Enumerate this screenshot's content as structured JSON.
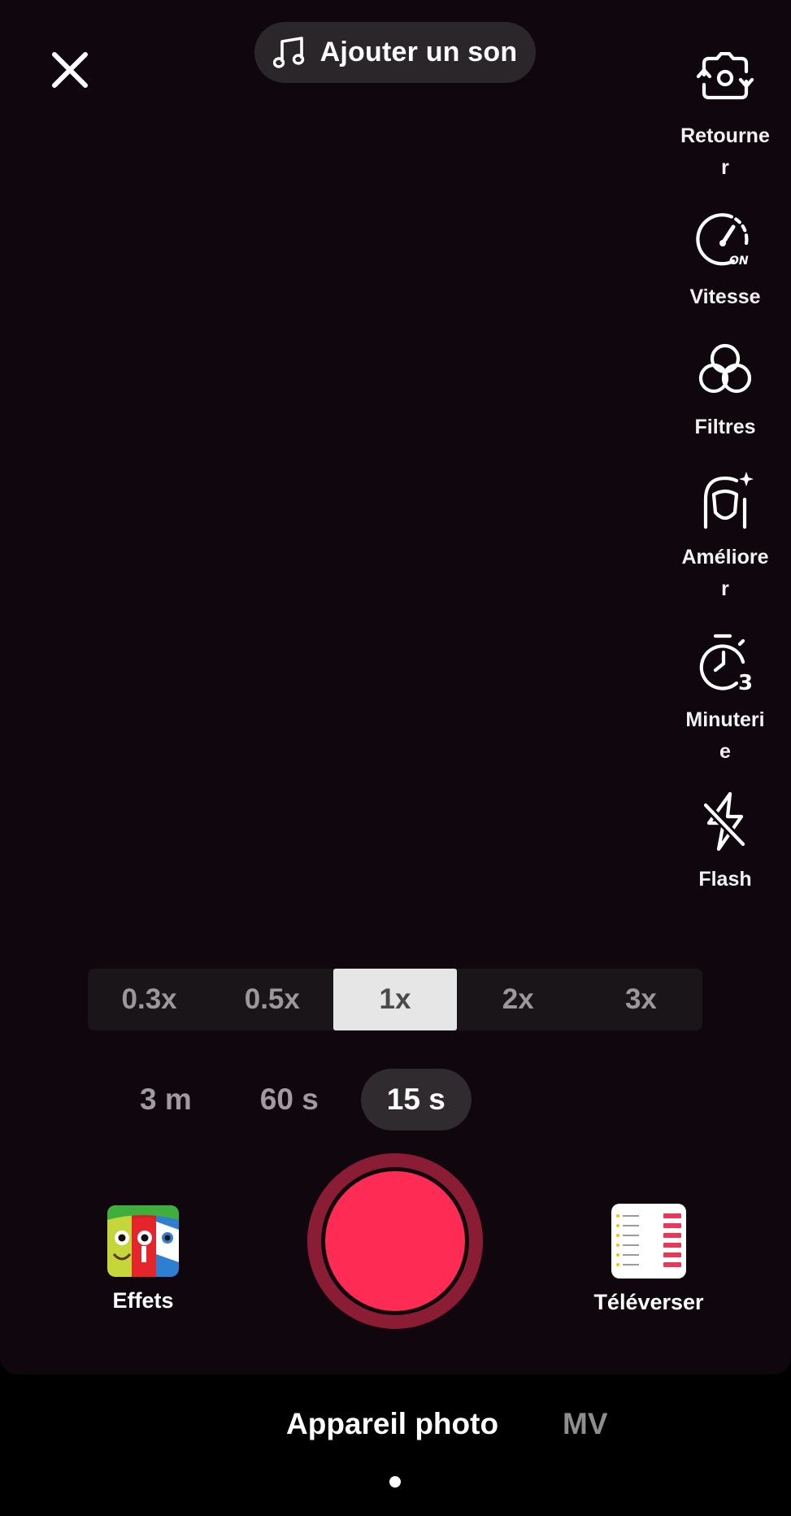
{
  "top": {
    "add_sound_label": "Ajouter un son"
  },
  "side_tools": [
    {
      "label": "Retourner",
      "icon": "flip-camera-icon"
    },
    {
      "label": "Vitesse",
      "icon": "speed-icon",
      "badge": "ON"
    },
    {
      "label": "Filtres",
      "icon": "filters-icon"
    },
    {
      "label": "Améliorer",
      "icon": "enhance-icon"
    },
    {
      "label": "Minuterie",
      "icon": "timer-icon",
      "badge": "3"
    },
    {
      "label": "Flash",
      "icon": "flash-off-icon"
    }
  ],
  "speed_options": [
    "0.3x",
    "0.5x",
    "1x",
    "2x",
    "3x"
  ],
  "speed_selected": "1x",
  "duration_options": [
    "3 m",
    "60 s",
    "15 s"
  ],
  "duration_selected": "15 s",
  "bottom": {
    "effects_label": "Effets",
    "upload_label": "Téléverser"
  },
  "modes": {
    "active": "Appareil photo",
    "inactive": "MV"
  },
  "colors": {
    "record": "#fe2c55",
    "record_ring": "#8a1d34",
    "background": "#0f070d"
  }
}
